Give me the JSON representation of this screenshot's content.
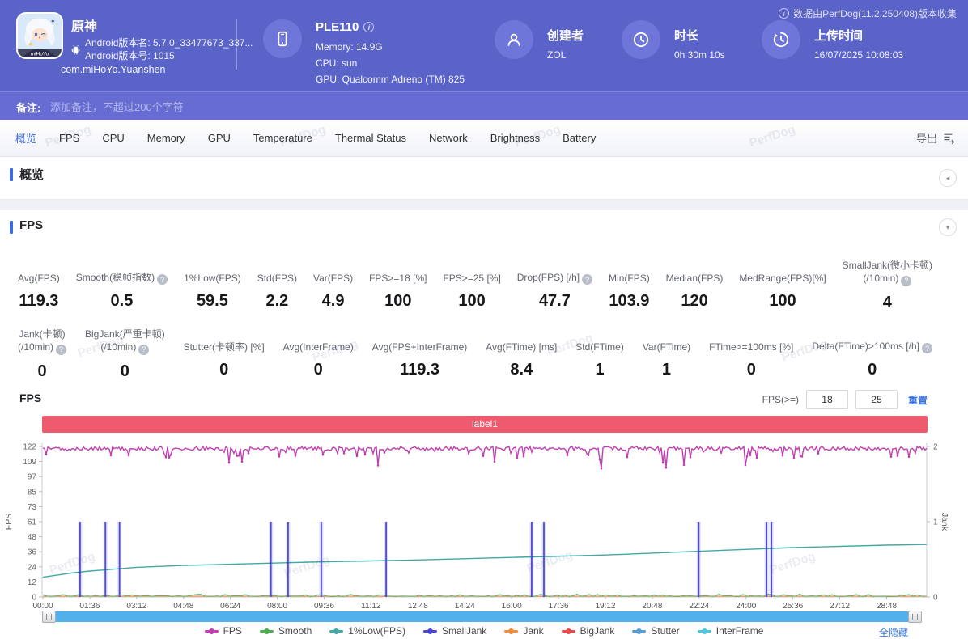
{
  "header": {
    "app": {
      "title": "原神",
      "android_version_name": "Android版本名: 5.7.0_33477673_337...",
      "android_version_code": "Android版本号: 1015",
      "package": "com.miHoYo.Yuanshen",
      "icon_caption": "miHoYo"
    },
    "device": {
      "name": "PLE110",
      "memory": "Memory: 14.9G",
      "cpu": "CPU: sun",
      "gpu": "GPU: Qualcomm Adreno (TM) 825"
    },
    "creator": {
      "label": "创建者",
      "value": "ZOL"
    },
    "duration": {
      "label": "时长",
      "value": "0h 30m 10s"
    },
    "upload": {
      "label": "上传时间",
      "value": "16/07/2025 10:08:03"
    },
    "collect_note": "数据由PerfDog(11.2.250408)版本收集"
  },
  "note_bar": {
    "label": "备注:",
    "placeholder": "添加备注，不超过200个字符"
  },
  "tabs": {
    "active": "概览",
    "items": [
      "概览",
      "FPS",
      "CPU",
      "Memory",
      "GPU",
      "Temperature",
      "Thermal Status",
      "Network",
      "Brightness",
      "Battery"
    ],
    "export_label": "导出"
  },
  "sections": {
    "overview_title": "概览",
    "fps_title": "FPS"
  },
  "stats": {
    "row1": [
      {
        "lines": [
          "Avg(FPS)"
        ],
        "value": "119.3",
        "help": false
      },
      {
        "lines": [
          "Smooth(稳帧指数)"
        ],
        "value": "0.5",
        "help": true
      },
      {
        "lines": [
          "1%Low(FPS)"
        ],
        "value": "59.5",
        "help": false
      },
      {
        "lines": [
          "Std(FPS)"
        ],
        "value": "2.2",
        "help": false
      },
      {
        "lines": [
          "Var(FPS)"
        ],
        "value": "4.9",
        "help": false
      },
      {
        "lines": [
          "FPS>=18 [%]"
        ],
        "value": "100",
        "help": false
      },
      {
        "lines": [
          "FPS>=25 [%]"
        ],
        "value": "100",
        "help": false
      },
      {
        "lines": [
          "Drop(FPS) [/h]"
        ],
        "value": "47.7",
        "help": true
      },
      {
        "lines": [
          "Min(FPS)"
        ],
        "value": "103.9",
        "help": false
      },
      {
        "lines": [
          "Median(FPS)"
        ],
        "value": "120",
        "help": false
      },
      {
        "lines": [
          "MedRange(FPS)[%]"
        ],
        "value": "100",
        "help": false
      },
      {
        "lines": [
          "SmallJank(微小卡顿)",
          "(/10min)"
        ],
        "value": "4",
        "help": true
      }
    ],
    "row2": [
      {
        "lines": [
          "Jank(卡顿)",
          "(/10min)"
        ],
        "value": "0",
        "help": true
      },
      {
        "lines": [
          "BigJank(严重卡顿)",
          "(/10min)"
        ],
        "value": "0",
        "help": true
      },
      {
        "lines": [
          "Stutter(卡顿率) [%]"
        ],
        "value": "0",
        "help": false
      },
      {
        "lines": [
          "Avg(InterFrame)"
        ],
        "value": "0",
        "help": false
      },
      {
        "lines": [
          "Avg(FPS+InterFrame)"
        ],
        "value": "119.3",
        "help": false
      },
      {
        "lines": [
          "Avg(FTime) [ms]"
        ],
        "value": "8.4",
        "help": false
      },
      {
        "lines": [
          "Std(FTime)"
        ],
        "value": "1",
        "help": false
      },
      {
        "lines": [
          "Var(FTime)"
        ],
        "value": "1",
        "help": false
      },
      {
        "lines": [
          "FTime>=100ms [%]"
        ],
        "value": "0",
        "help": false
      },
      {
        "lines": [
          "Delta(FTime)>100ms [/h]"
        ],
        "value": "0",
        "help": true
      }
    ]
  },
  "fps_chart": {
    "title": "FPS",
    "filter_label": "FPS(>=)",
    "filter_values": [
      "18",
      "25"
    ],
    "reset_label": "重置",
    "hide_all_label": "全隐藏"
  },
  "chart_data": {
    "type": "line",
    "title": "label1",
    "ylabel": "FPS",
    "y2label": "Jank",
    "ylim": [
      0,
      122
    ],
    "y2lim": [
      0,
      2
    ],
    "yticks": [
      0,
      12,
      24,
      36,
      48,
      61,
      73,
      85,
      97,
      109,
      122
    ],
    "y2ticks": [
      0,
      1,
      2
    ],
    "x_ticks": [
      "00:00",
      "01:36",
      "03:12",
      "04:48",
      "06:24",
      "08:00",
      "09:36",
      "11:12",
      "12:48",
      "14:24",
      "16:00",
      "17:36",
      "19:12",
      "20:48",
      "22:24",
      "24:00",
      "25:36",
      "27:12",
      "28:48"
    ],
    "x_tick_interval_seconds": 96,
    "duration_seconds": 1810,
    "legend_position": "bottom",
    "series": [
      {
        "name": "FPS",
        "color": "#c23fb3",
        "style": "noisy-line",
        "baseline": 120.4,
        "noise": 1.5,
        "small_dip_probability": 0.12,
        "small_dip_depth": [
          2.5,
          7.5
        ],
        "deep_dip_probability": 0.013,
        "deep_dip_depth": [
          9,
          16.5
        ],
        "min": 103.9,
        "max": 122,
        "seed": 11
      },
      {
        "name": "Smooth",
        "color": "#4cae50",
        "style": "noise-floor",
        "base": 0,
        "amplitude": 2.2,
        "seed": 5
      },
      {
        "name": "1%Low(FPS)",
        "color": "#3fa9a5",
        "style": "curve",
        "points": [
          [
            0,
            16
          ],
          [
            60,
            19.5
          ],
          [
            96,
            21
          ],
          [
            192,
            24
          ],
          [
            288,
            25.5
          ],
          [
            384,
            26.5
          ],
          [
            480,
            27.5
          ],
          [
            576,
            28.5
          ],
          [
            672,
            29.2
          ],
          [
            768,
            30
          ],
          [
            960,
            32
          ],
          [
            1152,
            34
          ],
          [
            1344,
            37
          ],
          [
            1536,
            40
          ],
          [
            1728,
            42
          ],
          [
            1810,
            42.5
          ]
        ]
      },
      {
        "name": "SmallJank",
        "color": "#4844d2",
        "style": "event-spikes",
        "axis": "right",
        "spike_value": 1,
        "event_times_seconds": [
          76,
          128,
          157,
          467,
          502,
          570,
          703,
          1001,
          1026,
          1343,
          1482,
          1492
        ]
      },
      {
        "name": "Jank",
        "color": "#f08c3c",
        "style": "flat",
        "value": 0
      },
      {
        "name": "BigJank",
        "color": "#e94b4b",
        "style": "flat",
        "value": 0
      },
      {
        "name": "Stutter",
        "color": "#5b9bd5",
        "style": "flat",
        "value": 0
      },
      {
        "name": "InterFrame",
        "color": "#4fc8de",
        "style": "flat",
        "value": 0
      }
    ]
  },
  "icons": {
    "overview_collapse": "◂",
    "fps_collapse": "▾"
  },
  "watermark": {
    "text": "PerfDog"
  },
  "colors": {
    "accent_blue": "#3f6bdb",
    "header_bg": "#5a63c8",
    "banner_red": "#ee5a6e",
    "scrollbar_blue": "#52b1ea"
  }
}
